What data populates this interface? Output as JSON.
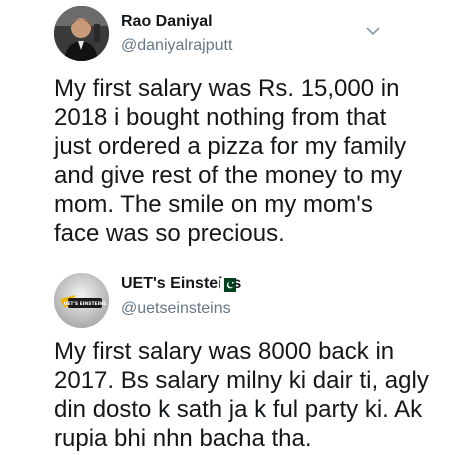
{
  "tweets": [
    {
      "name": "Rao Daniyal",
      "handle": "@daniyalrajputt",
      "text": "My first salary was Rs. 15,000 in\n2018 i bought nothing from that\njust ordered a pizza for my family\nand give rest of the money to my\nmom. The smile on my mom's\nface was so precious.",
      "avatar": "profile-photo",
      "menu_icon": "chevron-down-icon"
    },
    {
      "name": "UET's Einsteins",
      "handle": "@uetseinsteins",
      "badge_icon": "pakistan-flag-icon",
      "text": "My first salary was 8000 back in\n2017. Bs salary milny ki dair ti, agly\ndin dosto k sath ja k ful party ki. Ak\nrupia bhi nhn bacha tha.",
      "avatar": "uets-einsteins-logo",
      "avatar_logo_text": "UET'S EINSTEINS"
    }
  ],
  "colors": {
    "text": "#14171a",
    "secondary_text": "#657786",
    "background": "#ffffff",
    "flag_green": "#01411c"
  }
}
